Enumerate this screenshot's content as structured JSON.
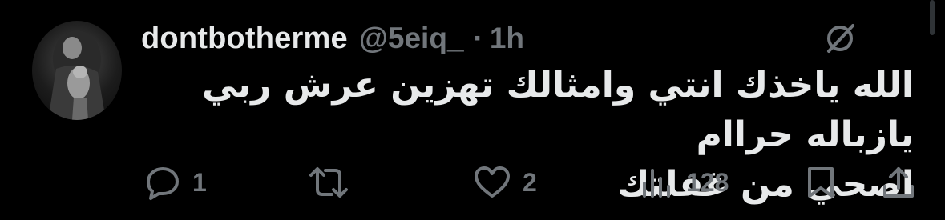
{
  "tweet": {
    "display_name": "dontbotherme",
    "handle": "@5eiq_",
    "separator": "·",
    "time": "1h",
    "text": "الله ياخذك انتي وامثالك تهزين عرش ربي يازباله حراام\nاصحي من غفلتك"
  },
  "actions": {
    "reply": {
      "icon": "reply-icon",
      "count": "1"
    },
    "retweet": {
      "icon": "retweet-icon",
      "count": ""
    },
    "like": {
      "icon": "heart-icon",
      "count": "2"
    },
    "views": {
      "icon": "views-icon",
      "count": "128"
    },
    "bookmark": {
      "icon": "bookmark-icon"
    },
    "share": {
      "icon": "share-icon"
    }
  },
  "colors": {
    "background": "#000000",
    "primary_text": "#e7e9ea",
    "secondary_text": "#71767b"
  }
}
